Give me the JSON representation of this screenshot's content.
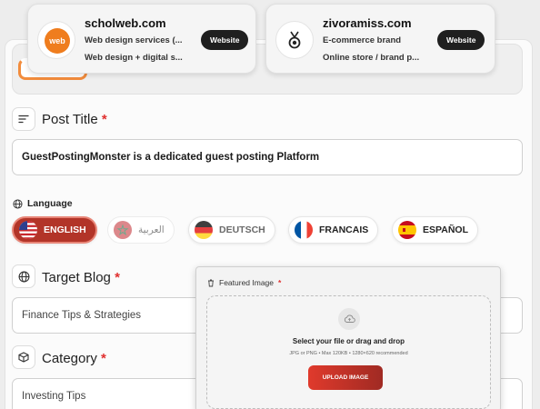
{
  "site_cards": [
    {
      "logo_text": "web",
      "name": "scholweb.com",
      "description": "Web design services (...",
      "subtitle": "Web design + digital s...",
      "button_label": "Website"
    },
    {
      "name": "zivoramiss.com",
      "description": "E-commerce brand",
      "subtitle": "Online store / brand p...",
      "button_label": "Website"
    }
  ],
  "post_title": {
    "label": "Post Title",
    "required_mark": "*",
    "value": "GuestPostingMonster is a dedicated guest posting Platform"
  },
  "language": {
    "label": "Language",
    "options": [
      {
        "label": "ENGLISH",
        "flag": "us-flag",
        "selected": true
      },
      {
        "label": "العربية",
        "flag": "morocco-flag",
        "selected": false
      },
      {
        "label": "DEUTSCH",
        "flag": "germany-flag",
        "selected": false
      },
      {
        "label": "FRANCAIS",
        "flag": "france-flag",
        "selected": false
      },
      {
        "label": "ESPAÑOL",
        "flag": "spain-flag",
        "selected": false
      }
    ]
  },
  "target_blog": {
    "label": "Target Blog",
    "required_mark": "*",
    "value": "Finance Tips & Strategies"
  },
  "category": {
    "label": "Category",
    "required_mark": "*",
    "value": "Investing Tips"
  },
  "featured_image": {
    "label": "Featured Image",
    "required_mark": "*",
    "drop_title": "Select your file or drag and drop",
    "hint": "JPG or PNG • Max 120KB • 1280×620 recommended",
    "button_label": "UPLOAD IMAGE"
  },
  "colors": {
    "accent_red": "#b23428",
    "required_red": "#e0302f",
    "dark_button": "#1f1f1f",
    "logo_orange": "#ef7d1e"
  }
}
